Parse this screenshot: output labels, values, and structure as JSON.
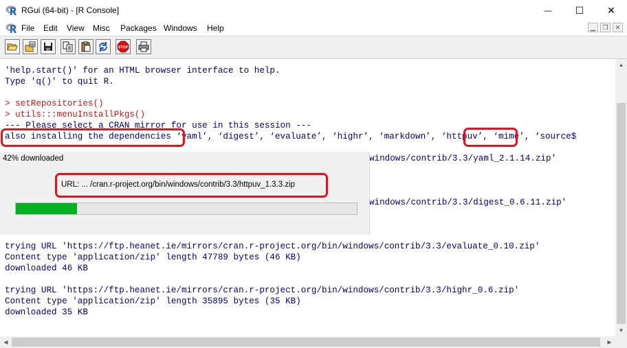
{
  "window": {
    "title": "RGui (64-bit) - [R Console]",
    "minimize_glyph": "—",
    "maximize_glyph": "☐",
    "close_glyph": "✕"
  },
  "menu": {
    "items": [
      "File",
      "Edit",
      "View",
      "Misc",
      "Packages",
      "Windows",
      "Help"
    ],
    "mdi_minimize": "▁",
    "mdi_restore": "❐",
    "mdi_close": "✕"
  },
  "toolbar": {
    "icons": [
      "open-script-icon",
      "load-workspace-icon",
      "save-workspace-icon",
      "copy-icon",
      "paste-icon",
      "copy-paste-icon",
      "stop-icon",
      "print-icon"
    ]
  },
  "console": {
    "lines": [
      "'help.start()' for an HTML browser interface to help.",
      "Type 'q()' to quit R.",
      "",
      "> setRepositories()",
      "> utils:::menuInstallPkgs()",
      "--- Please select a CRAN mirror for use in this session ---",
      "also installing the dependencies ‘yaml’, ‘digest’, ‘evaluate’, ‘highr’, ‘markdown’, ‘httpuv’, ‘mime’, ‘source$",
      "",
      "windows/contrib/3.3/yaml_2.1.14.zip'",
      "windows/contrib/3.3/digest_0.6.11.zip'",
      "trying URL 'https://ftp.heanet.ie/mirrors/cran.r-project.org/bin/windows/contrib/3.3/evaluate_0.10.zip'",
      "Content type 'application/zip' length 47789 bytes (46 KB)",
      "downloaded 46 KB",
      "trying URL 'https://ftp.heanet.ie/mirrors/cran.r-project.org/bin/windows/contrib/3.3/highr_0.6.zip'",
      "Content type 'application/zip' length 35895 bytes (35 KB)",
      "downloaded 35 KB"
    ]
  },
  "download": {
    "caption": "42% downloaded",
    "url": "URL: ... /cran.r-project.org/bin/windows/contrib/3.3/httpuv_1.3.3.zip",
    "progress": 0.18
  },
  "colors": {
    "console_text": "#000080",
    "command_text": "#e01010",
    "progress_fill": "#06b025",
    "annotation": "#e8101a"
  }
}
